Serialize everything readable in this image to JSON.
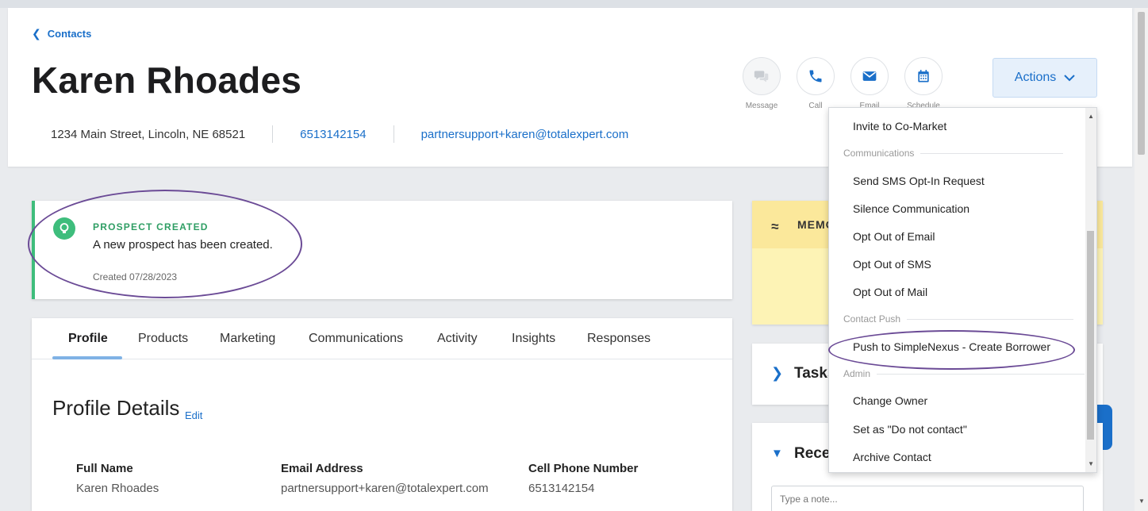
{
  "header": {
    "back_label": "Contacts",
    "name": "Karen Rhoades",
    "address": "1234 Main Street, Lincoln, NE 68521",
    "phone": "6513142154",
    "email": "partnersupport+karen@totalexpert.com",
    "quick_actions": [
      {
        "label": "Message",
        "icon": "message-icon"
      },
      {
        "label": "Call",
        "icon": "phone-icon"
      },
      {
        "label": "Email",
        "icon": "envelope-icon"
      },
      {
        "label": "Schedule",
        "icon": "calendar-icon"
      }
    ],
    "actions_label": "Actions"
  },
  "prospect": {
    "title": "PROSPECT CREATED",
    "message": "A new prospect has been created.",
    "created": "Created 07/28/2023"
  },
  "tabs": [
    "Profile",
    "Products",
    "Marketing",
    "Communications",
    "Activity",
    "Insights",
    "Responses"
  ],
  "profile": {
    "title": "Profile Details",
    "edit_label": "Edit",
    "fields": [
      {
        "label": "Full Name",
        "value": "Karen Rhoades"
      },
      {
        "label": "Email Address",
        "value": "partnersupport+karen@totalexpert.com"
      },
      {
        "label": "Cell Phone Number",
        "value": "6513142154"
      }
    ]
  },
  "right": {
    "memo_label": "MEMO",
    "tasks_label": "Tasks",
    "recent_label": "Recent",
    "note_placeholder": "Type a note..."
  },
  "dropdown": {
    "invite": "Invite to Co-Market",
    "sec_communications": "Communications",
    "sms_optin": "Send SMS Opt-In Request",
    "silence": "Silence Communication",
    "optout_email": "Opt Out of Email",
    "optout_sms": "Opt Out of SMS",
    "optout_mail": "Opt Out of Mail",
    "sec_push": "Contact Push",
    "push_simplenexus": "Push to SimpleNexus - Create Borrower",
    "sec_admin": "Admin",
    "change_owner": "Change Owner",
    "do_not_contact": "Set as \"Do not contact\"",
    "archive": "Archive Contact"
  },
  "colors": {
    "accent": "#1a6fc9",
    "success": "#3ebd7c",
    "annotation": "#6b4b96",
    "memo": "#fdf3b5"
  }
}
